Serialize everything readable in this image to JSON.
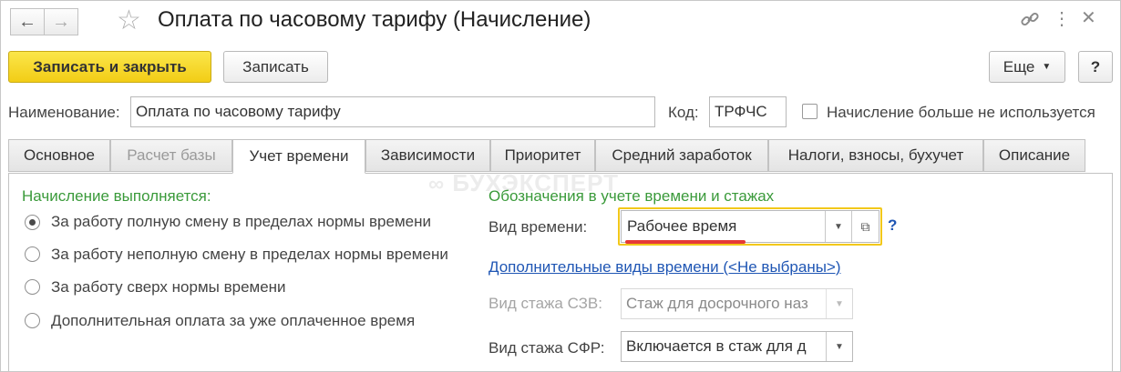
{
  "window": {
    "title": "Оплата по часовому тарифу (Начисление)"
  },
  "toolbar": {
    "save_close_label": "Записать и закрыть",
    "save_label": "Записать",
    "more_label": "Еще",
    "help_label": "?"
  },
  "fields": {
    "name_label": "Наименование:",
    "name_value": "Оплата по часовому тарифу",
    "code_label": "Код:",
    "code_value": "ТРФЧС",
    "not_used_label": "Начисление больше не используется"
  },
  "tabs": [
    {
      "label": "Основное"
    },
    {
      "label": "Расчет базы"
    },
    {
      "label": "Учет времени"
    },
    {
      "label": "Зависимости"
    },
    {
      "label": "Приоритет"
    },
    {
      "label": "Средний заработок"
    },
    {
      "label": "Налоги, взносы, бухучет"
    },
    {
      "label": "Описание"
    }
  ],
  "left_section": {
    "heading": "Начисление выполняется:",
    "options": [
      {
        "label": "За работу полную смену в пределах нормы времени",
        "selected": true
      },
      {
        "label": "За работу неполную смену в пределах нормы времени",
        "selected": false
      },
      {
        "label": "За работу сверх нормы времени",
        "selected": false
      },
      {
        "label": "Дополнительная оплата за уже оплаченное время",
        "selected": false
      }
    ]
  },
  "right_section": {
    "heading": "Обозначения в учете времени и стажах",
    "time_type_label": "Вид времени:",
    "time_type_value": "Рабочее время",
    "help_mark": "?",
    "extra_link": "Дополнительные виды времени (<Не выбраны>)",
    "szv_label": "Вид стажа СЗВ:",
    "szv_value": "Стаж для досрочного наз",
    "sfr_label": "Вид стажа СФР:",
    "sfr_value": "Включается в стаж для д"
  },
  "watermark": "БУХЭКСПЕРТ",
  "colors": {
    "primary_button": "#f2cd16",
    "section_heading": "#3a9a3a",
    "highlight_box": "#f2c81a",
    "underline": "#e53935",
    "link": "#1f56b4"
  }
}
